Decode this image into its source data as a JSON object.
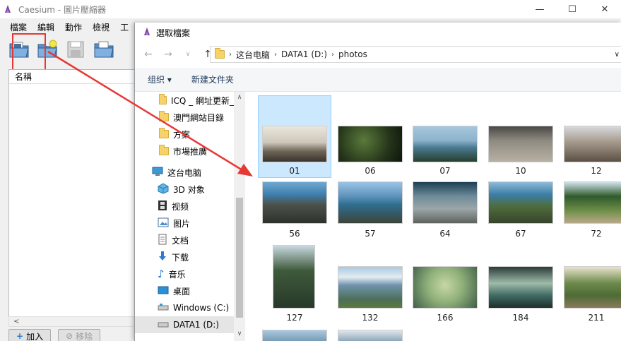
{
  "caesium": {
    "title": "Caesium - 圖片壓縮器",
    "menu": [
      "檔案",
      "編輯",
      "動作",
      "檢視",
      "工"
    ],
    "list_header": "名稱",
    "add_label": "加入",
    "remove_label": "移除",
    "window_controls": {
      "minimize": "—",
      "maximize": "☐",
      "close": "✕"
    }
  },
  "dialog": {
    "title": "選取檔案",
    "breadcrumb": [
      "这台电脑",
      "DATA1 (D:)",
      "photos"
    ],
    "organize_label": "组织 ▾",
    "new_folder_label": "新建文件夹",
    "nav_items": [
      {
        "label": "ICQ _ 網址更新_",
        "icon": "folder-icon"
      },
      {
        "label": "澳門網站目錄",
        "icon": "folder-icon"
      },
      {
        "label": "方案",
        "icon": "folder-icon"
      },
      {
        "label": "市場推廣",
        "icon": "folder-icon"
      },
      {
        "label": "这台电脑",
        "icon": "computer-icon"
      },
      {
        "label": "3D 对象",
        "icon": "cube-icon"
      },
      {
        "label": "视频",
        "icon": "film-icon"
      },
      {
        "label": "图片",
        "icon": "picture-icon"
      },
      {
        "label": "文档",
        "icon": "document-icon"
      },
      {
        "label": "下载",
        "icon": "download-icon"
      },
      {
        "label": "音乐",
        "icon": "music-icon"
      },
      {
        "label": "桌面",
        "icon": "desktop-icon"
      },
      {
        "label": "Windows (C:)",
        "icon": "drive-icon"
      },
      {
        "label": "DATA1 (D:)",
        "icon": "drive-icon"
      }
    ],
    "files": [
      "01",
      "06",
      "07",
      "10",
      "12",
      "56",
      "57",
      "64",
      "67",
      "72",
      "127",
      "132",
      "166",
      "184",
      "211"
    ]
  },
  "colors": {
    "highlight_red": "#e53935",
    "selection_blue": "#cce8ff",
    "folder_yellow": "#f6d26b"
  }
}
